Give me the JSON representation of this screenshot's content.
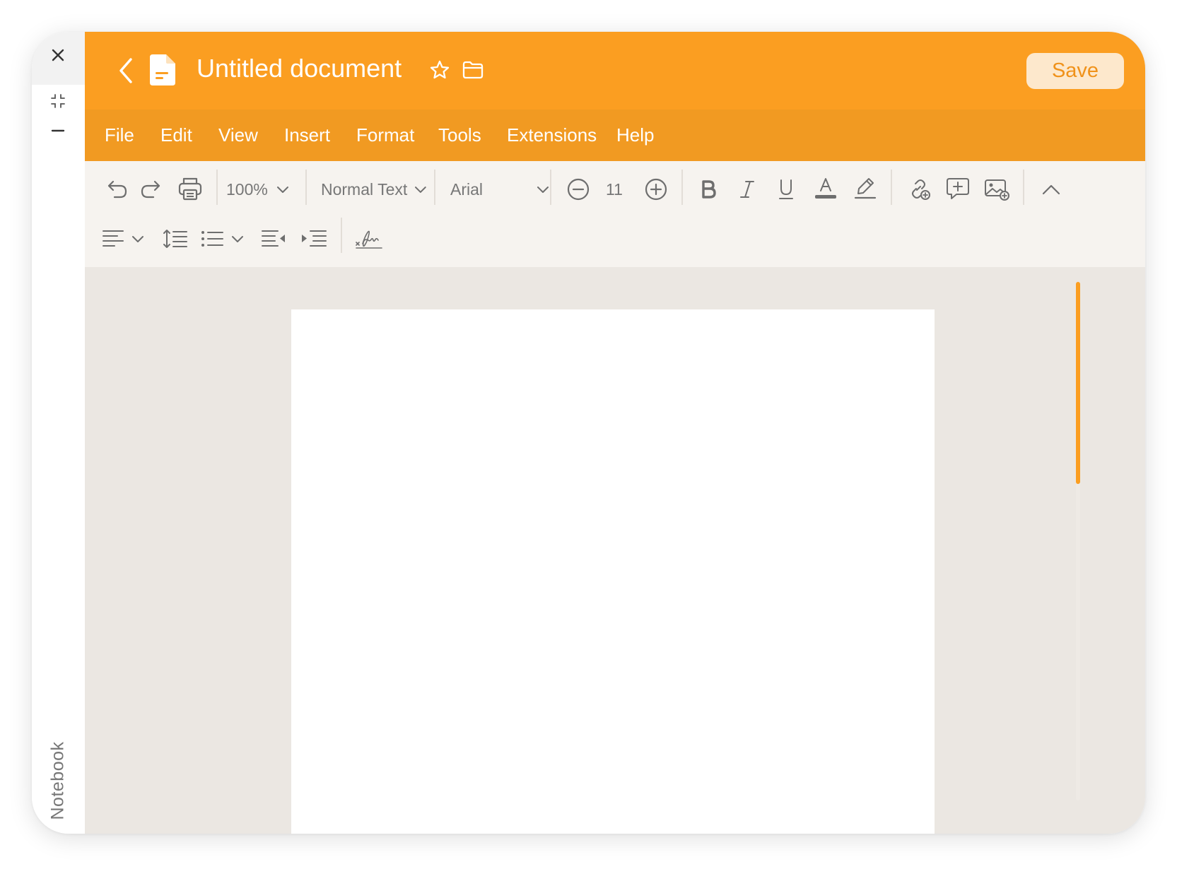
{
  "document": {
    "title": "Untitled document"
  },
  "titlebar": {
    "save_label": "Save"
  },
  "menu": [
    {
      "label": "File"
    },
    {
      "label": "Edit"
    },
    {
      "label": "View"
    },
    {
      "label": "Insert"
    },
    {
      "label": "Format"
    },
    {
      "label": "Tools"
    },
    {
      "label": "Extensions"
    },
    {
      "label": "Help"
    }
  ],
  "toolbar": {
    "zoom": "100%",
    "paragraph_style": "Normal Text",
    "font": "Arial",
    "font_size": "11"
  },
  "side_rail": {
    "label": "Notebook"
  },
  "scroll": {
    "position_fraction": 0.0,
    "visible_fraction": 0.39
  },
  "colors": {
    "accent": "#fb9e21",
    "menubar": "#f19a22",
    "save_button_bg": "#fde8cc",
    "toolbar_bg": "#f6f3ef",
    "canvas_bg": "#ebe7e2"
  }
}
